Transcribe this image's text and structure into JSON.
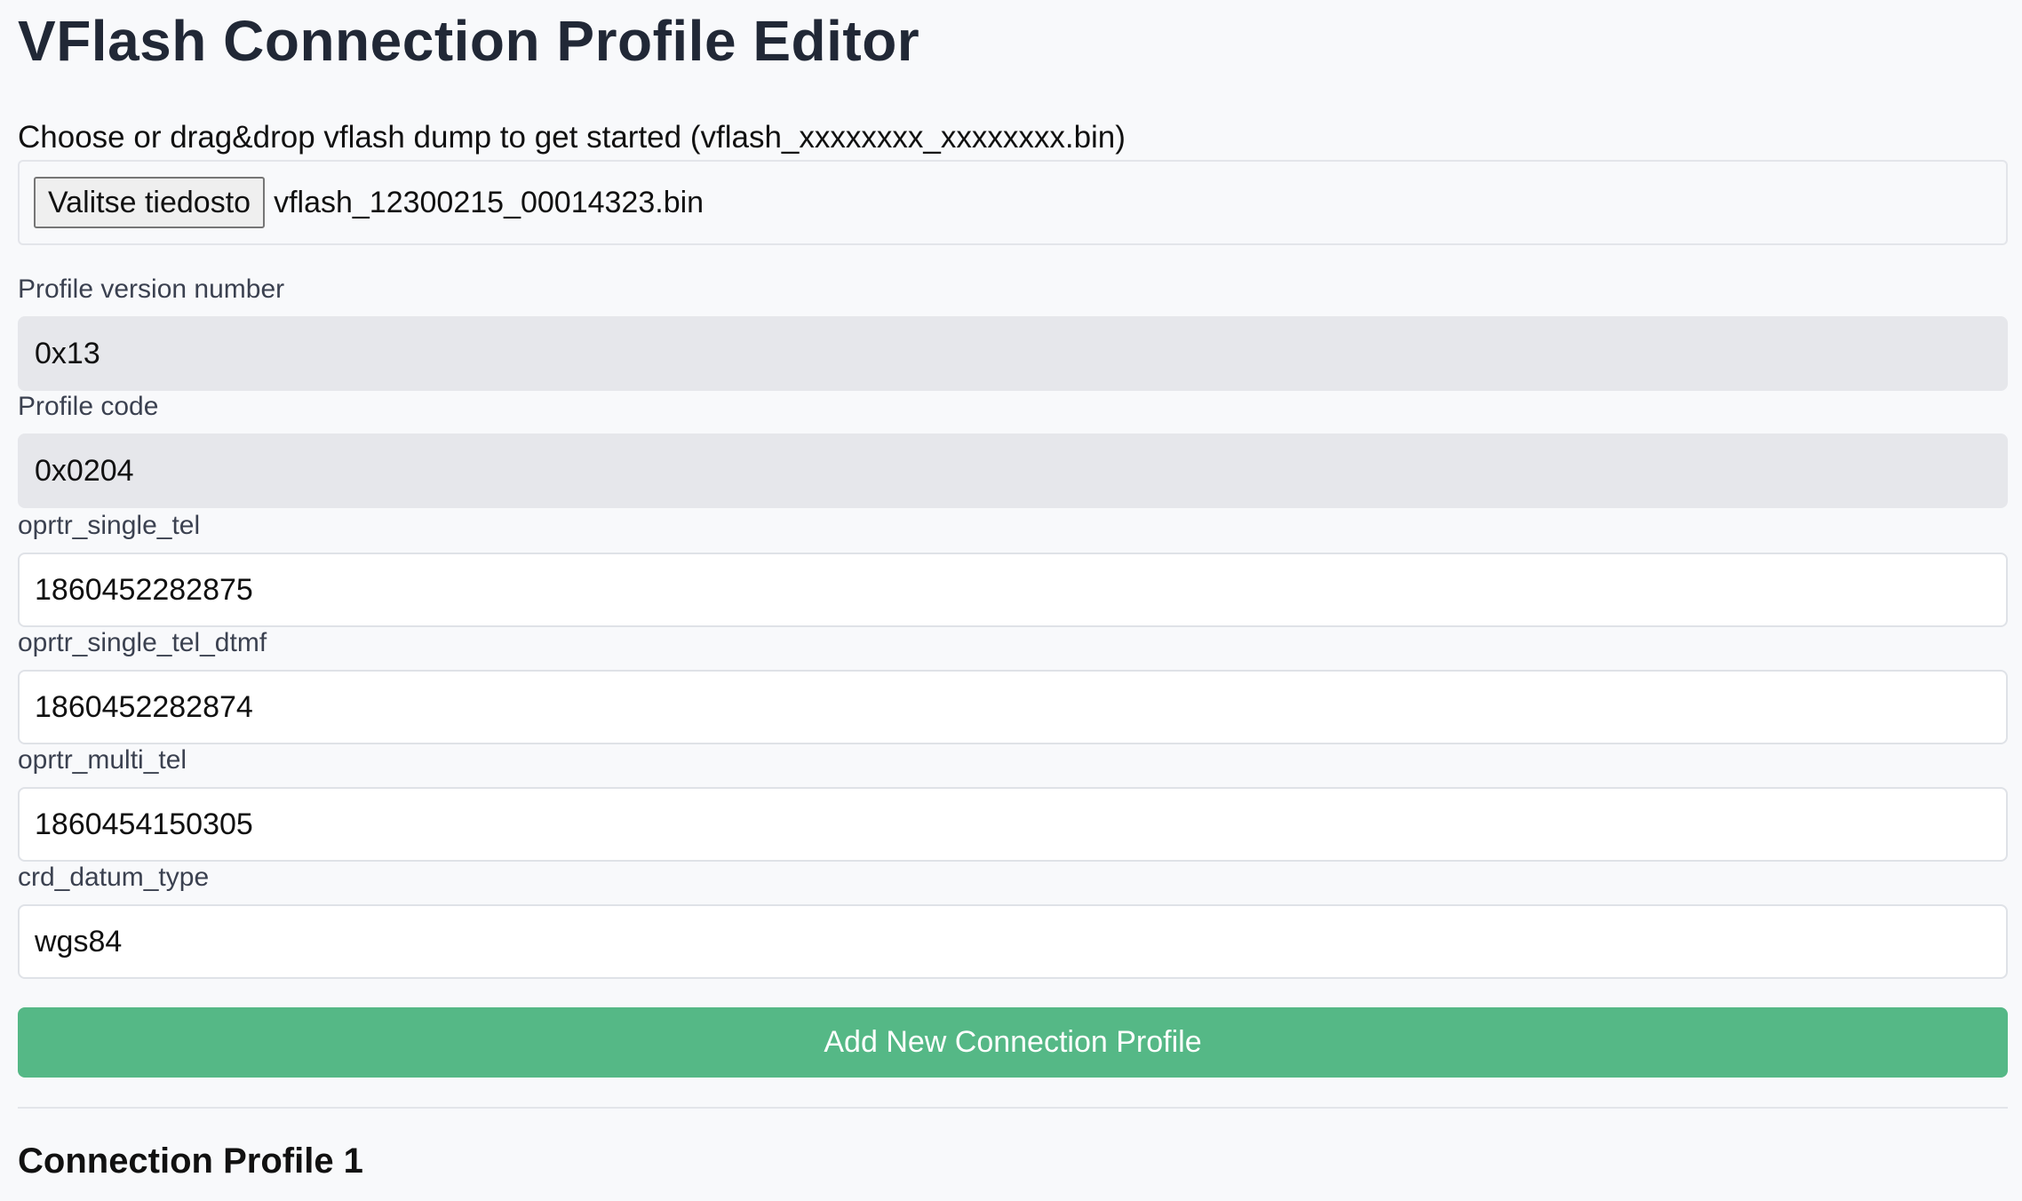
{
  "page": {
    "title": "VFlash Connection Profile Editor"
  },
  "file_picker": {
    "instruction": "Choose or drag&drop vflash dump to get started (vflash_xxxxxxxx_xxxxxxxx.bin)",
    "button_label": "Valitse tiedosto",
    "selected_file": "vflash_12300215_00014323.bin"
  },
  "fields": [
    {
      "label": "Profile version number",
      "value": "0x13",
      "readonly": true
    },
    {
      "label": "Profile code",
      "value": "0x0204",
      "readonly": true
    },
    {
      "label": "oprtr_single_tel",
      "value": "1860452282875",
      "readonly": false
    },
    {
      "label": "oprtr_single_tel_dtmf",
      "value": "1860452282874",
      "readonly": false
    },
    {
      "label": "oprtr_multi_tel",
      "value": "1860454150305",
      "readonly": false
    },
    {
      "label": "crd_datum_type",
      "value": "wgs84",
      "readonly": false
    }
  ],
  "actions": {
    "add_profile_label": "Add New Connection Profile"
  },
  "profiles_section": {
    "first_profile_title": "Connection Profile 1"
  },
  "colors": {
    "accent_green": "#55b886",
    "title_text": "#212836",
    "readonly_bg": "#e6e7eb",
    "page_bg": "#f8f9fb"
  }
}
